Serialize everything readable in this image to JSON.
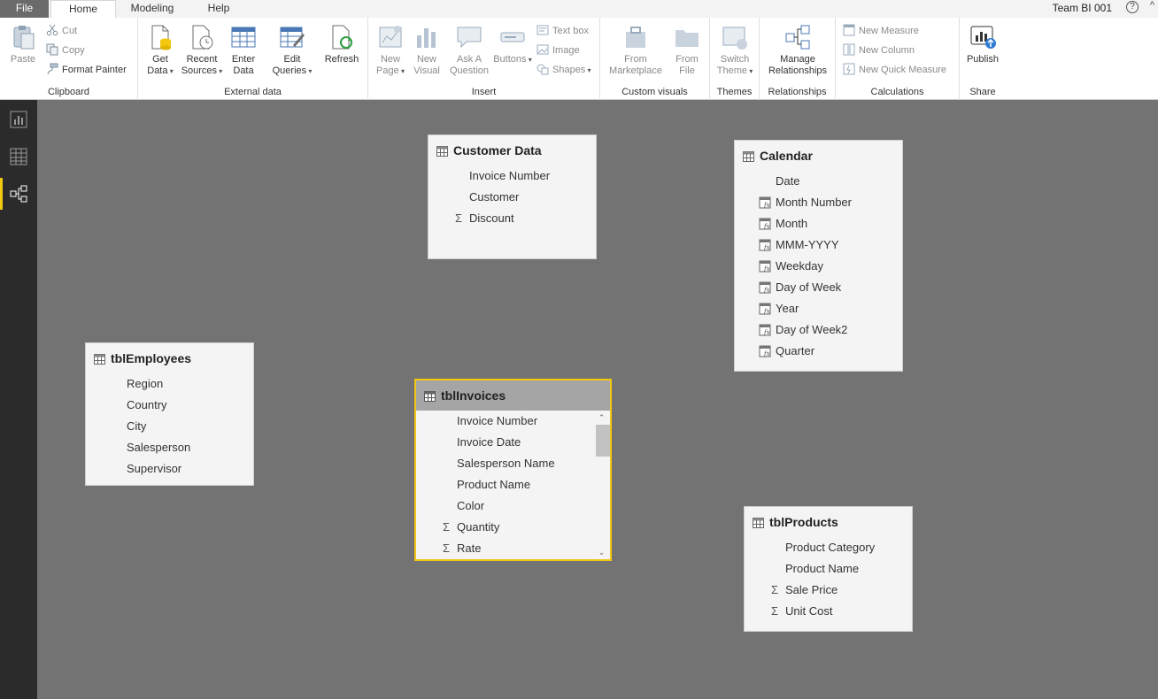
{
  "tabs": {
    "file": "File",
    "home": "Home",
    "modeling": "Modeling",
    "help": "Help"
  },
  "account": {
    "name": "Team BI 001",
    "help": "?",
    "collapse": "^"
  },
  "ribbon": {
    "clipboard": {
      "label": "Clipboard",
      "paste": "Paste",
      "cut": "Cut",
      "copy": "Copy",
      "format_painter": "Format Painter"
    },
    "external_data": {
      "label": "External data",
      "get_data": [
        "Get",
        "Data"
      ],
      "recent_sources": [
        "Recent",
        "Sources"
      ],
      "enter_data": [
        "Enter",
        "Data"
      ],
      "edit_queries": [
        "Edit",
        "Queries"
      ],
      "refresh": "Refresh"
    },
    "insert": {
      "label": "Insert",
      "new_page": [
        "New",
        "Page"
      ],
      "new_visual": [
        "New",
        "Visual"
      ],
      "ask_question": [
        "Ask A",
        "Question"
      ],
      "buttons": "Buttons",
      "text_box": "Text box",
      "image": "Image",
      "shapes": "Shapes"
    },
    "custom_visuals": {
      "label": "Custom visuals",
      "from_marketplace": [
        "From",
        "Marketplace"
      ],
      "from_file": [
        "From",
        "File"
      ]
    },
    "themes": {
      "label": "Themes",
      "switch_theme": [
        "Switch",
        "Theme"
      ]
    },
    "relationships": {
      "label": "Relationships",
      "manage": [
        "Manage",
        "Relationships"
      ]
    },
    "calculations": {
      "label": "Calculations",
      "new_measure": "New Measure",
      "new_column": "New Column",
      "new_quick_measure": "New Quick Measure"
    },
    "share": {
      "label": "Share",
      "publish": "Publish"
    }
  },
  "tables": [
    {
      "name": "Customer Data",
      "fields": [
        {
          "name": "Invoice Number",
          "icon": "none"
        },
        {
          "name": "Customer",
          "icon": "none"
        },
        {
          "name": "Discount",
          "icon": "sigma"
        }
      ]
    },
    {
      "name": "Calendar",
      "fields": [
        {
          "name": "Date",
          "icon": "none"
        },
        {
          "name": "Month Number",
          "icon": "calc-column"
        },
        {
          "name": "Month",
          "icon": "calc-column"
        },
        {
          "name": "MMM-YYYY",
          "icon": "calc-column"
        },
        {
          "name": "Weekday",
          "icon": "calc-column"
        },
        {
          "name": "Day of Week",
          "icon": "calc-column"
        },
        {
          "name": "Year",
          "icon": "calc-column"
        },
        {
          "name": "Day of Week2",
          "icon": "calc-column"
        },
        {
          "name": "Quarter",
          "icon": "calc-column"
        }
      ]
    },
    {
      "name": "tblEmployees",
      "fields": [
        {
          "name": "Region",
          "icon": "none"
        },
        {
          "name": "Country",
          "icon": "none"
        },
        {
          "name": "City",
          "icon": "none"
        },
        {
          "name": "Salesperson",
          "icon": "none"
        },
        {
          "name": "Supervisor",
          "icon": "none"
        }
      ]
    },
    {
      "name": "tblInvoices",
      "selected": true,
      "fields": [
        {
          "name": "Invoice Number",
          "icon": "none"
        },
        {
          "name": "Invoice Date",
          "icon": "none"
        },
        {
          "name": "Salesperson Name",
          "icon": "none"
        },
        {
          "name": "Product Name",
          "icon": "none"
        },
        {
          "name": "Color",
          "icon": "none"
        },
        {
          "name": "Quantity",
          "icon": "sigma"
        },
        {
          "name": "Rate",
          "icon": "sigma"
        }
      ]
    },
    {
      "name": "tblProducts",
      "fields": [
        {
          "name": "Product Category",
          "icon": "none"
        },
        {
          "name": "Product Name",
          "icon": "none"
        },
        {
          "name": "Sale Price",
          "icon": "sigma"
        },
        {
          "name": "Unit Cost",
          "icon": "sigma"
        }
      ]
    }
  ],
  "colors": {
    "accent": "#f2c811",
    "canvas": "#737373",
    "nav": "#2b2b2b",
    "file_tab": "#6b6b6b"
  }
}
